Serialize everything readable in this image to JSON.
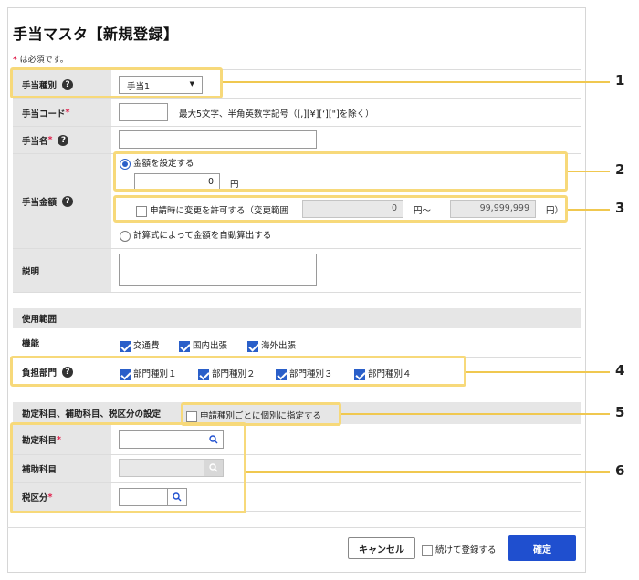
{
  "page": {
    "title": "手当マスタ【新規登録】",
    "required_note": "は必須です。",
    "required_mark": "*"
  },
  "form": {
    "allowance_type": {
      "label": "手当種別",
      "value": "手当1"
    },
    "allowance_code": {
      "label": "手当コード",
      "hint": "最大5文字、半角英数字記号（[,][¥][‘][\"]を除く）"
    },
    "allowance_name": {
      "label": "手当名"
    },
    "amount": {
      "label": "手当金額",
      "option_fixed": "金額を設定する",
      "amount_value": "0",
      "unit": "円",
      "allow_change_label": "申請時に変更を許可する（変更範囲",
      "range_min": "0",
      "range_sep": "円～",
      "range_max": "99,999,999",
      "range_end": "円）",
      "option_formula": "計算式によって金額を自動算出する"
    },
    "description": {
      "label": "説明"
    }
  },
  "usage": {
    "header": "使用範囲",
    "function_label": "機能",
    "functions": [
      "交通費",
      "国内出張",
      "海外出張"
    ],
    "dept_label": "負担部門",
    "departments": [
      "部門種別１",
      "部門種別２",
      "部門種別３",
      "部門種別４"
    ]
  },
  "accounts": {
    "header": "勘定科目、補助科目、税区分の設定",
    "per_type_label": "申請種別ごとに個別に指定する",
    "account_label": "勘定科目",
    "sub_account_label": "補助科目",
    "tax_label": "税区分"
  },
  "footer": {
    "cancel": "キャンセル",
    "continue_label": "続けて登録する",
    "confirm": "確定"
  },
  "callouts": [
    "1",
    "2",
    "3",
    "4",
    "5",
    "6"
  ],
  "colors": {
    "accent": "#1f4fcf",
    "highlight": "#f7d97a",
    "required": "#e0204c"
  }
}
